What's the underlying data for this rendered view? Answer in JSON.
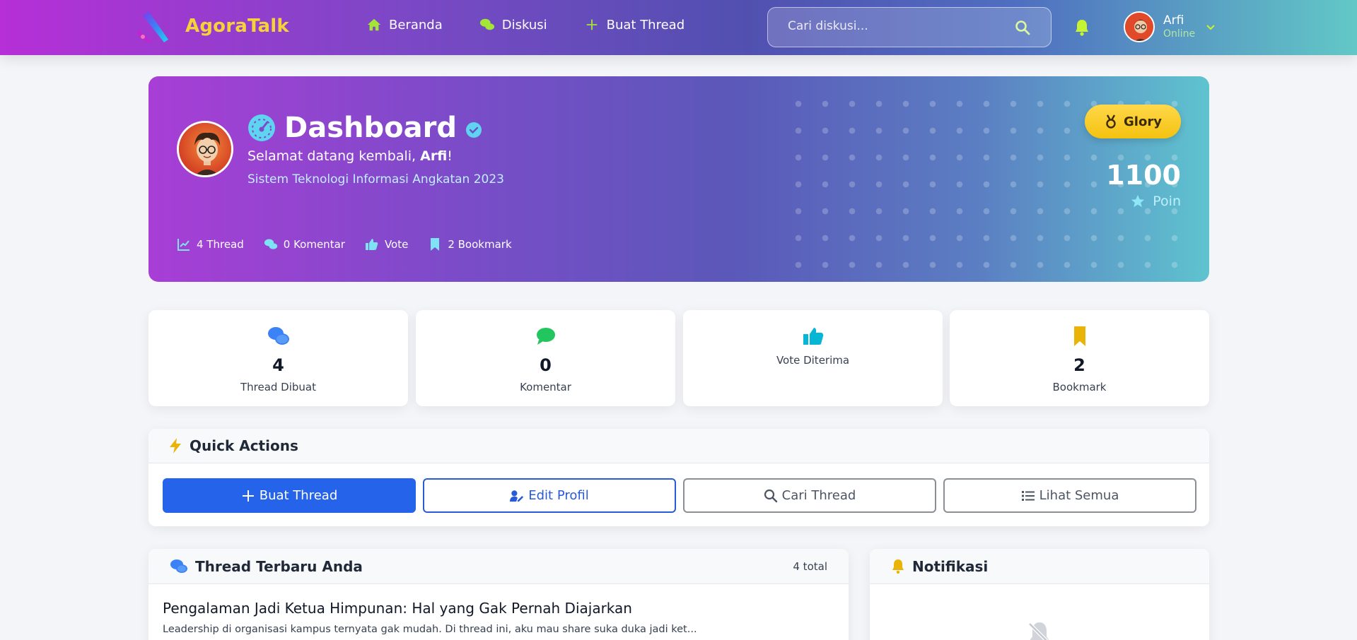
{
  "nav": {
    "brand": "AgoraTalk",
    "links": [
      {
        "label": "Beranda",
        "icon": "home-icon"
      },
      {
        "label": "Diskusi",
        "icon": "comments-icon"
      },
      {
        "label": "Buat Thread",
        "icon": "plus-icon"
      }
    ],
    "search_placeholder": "Cari diskusi...",
    "user": {
      "name": "Arfi",
      "status": "Online"
    }
  },
  "hero": {
    "title": "Dashboard",
    "welcome_prefix": "Selamat datang kembali, ",
    "welcome_name": "Arfi",
    "welcome_suffix": "!",
    "program": "Sistem Teknologi Informasi Angkatan 2023",
    "stats": [
      {
        "label": "4 Thread",
        "icon": "chart-line-icon"
      },
      {
        "label": "0 Komentar",
        "icon": "comments-icon"
      },
      {
        "label": "Vote",
        "icon": "thumbs-up-icon"
      },
      {
        "label": "2 Bookmark",
        "icon": "bookmark-icon"
      }
    ],
    "badge": "Glory",
    "points": "1100",
    "points_label": "Poin"
  },
  "stat_cards": [
    {
      "value": "4",
      "label": "Thread Dibuat",
      "icon": "comments-icon",
      "color": "#3b82f6"
    },
    {
      "value": "0",
      "label": "Komentar",
      "icon": "comment-icon",
      "color": "#22c55e"
    },
    {
      "value": "",
      "label": "Vote Diterima",
      "icon": "thumbs-up-icon",
      "color": "#06b6d4"
    },
    {
      "value": "2",
      "label": "Bookmark",
      "icon": "bookmark-icon",
      "color": "#eab308"
    }
  ],
  "quick_actions": {
    "title": "Quick Actions",
    "buttons": [
      {
        "label": "Buat Thread",
        "icon": "plus-icon"
      },
      {
        "label": "Edit Profil",
        "icon": "user-edit-icon"
      },
      {
        "label": "Cari Thread",
        "icon": "search-icon"
      },
      {
        "label": "Lihat Semua",
        "icon": "list-icon"
      }
    ]
  },
  "threads": {
    "title": "Thread Terbaru Anda",
    "count": "4 total",
    "items": [
      {
        "title": "Pengalaman Jadi Ketua Himpunan: Hal yang Gak Pernah Diajarkan",
        "excerpt": "Leadership di organisasi kampus ternyata gak mudah. Di thread ini, aku mau share suka duka jadi ket..."
      }
    ]
  },
  "notifications": {
    "title": "Notifikasi"
  },
  "colors": {
    "accent": "#2563eb",
    "brand": "#f6d23a",
    "gold": "#f4c20f"
  }
}
